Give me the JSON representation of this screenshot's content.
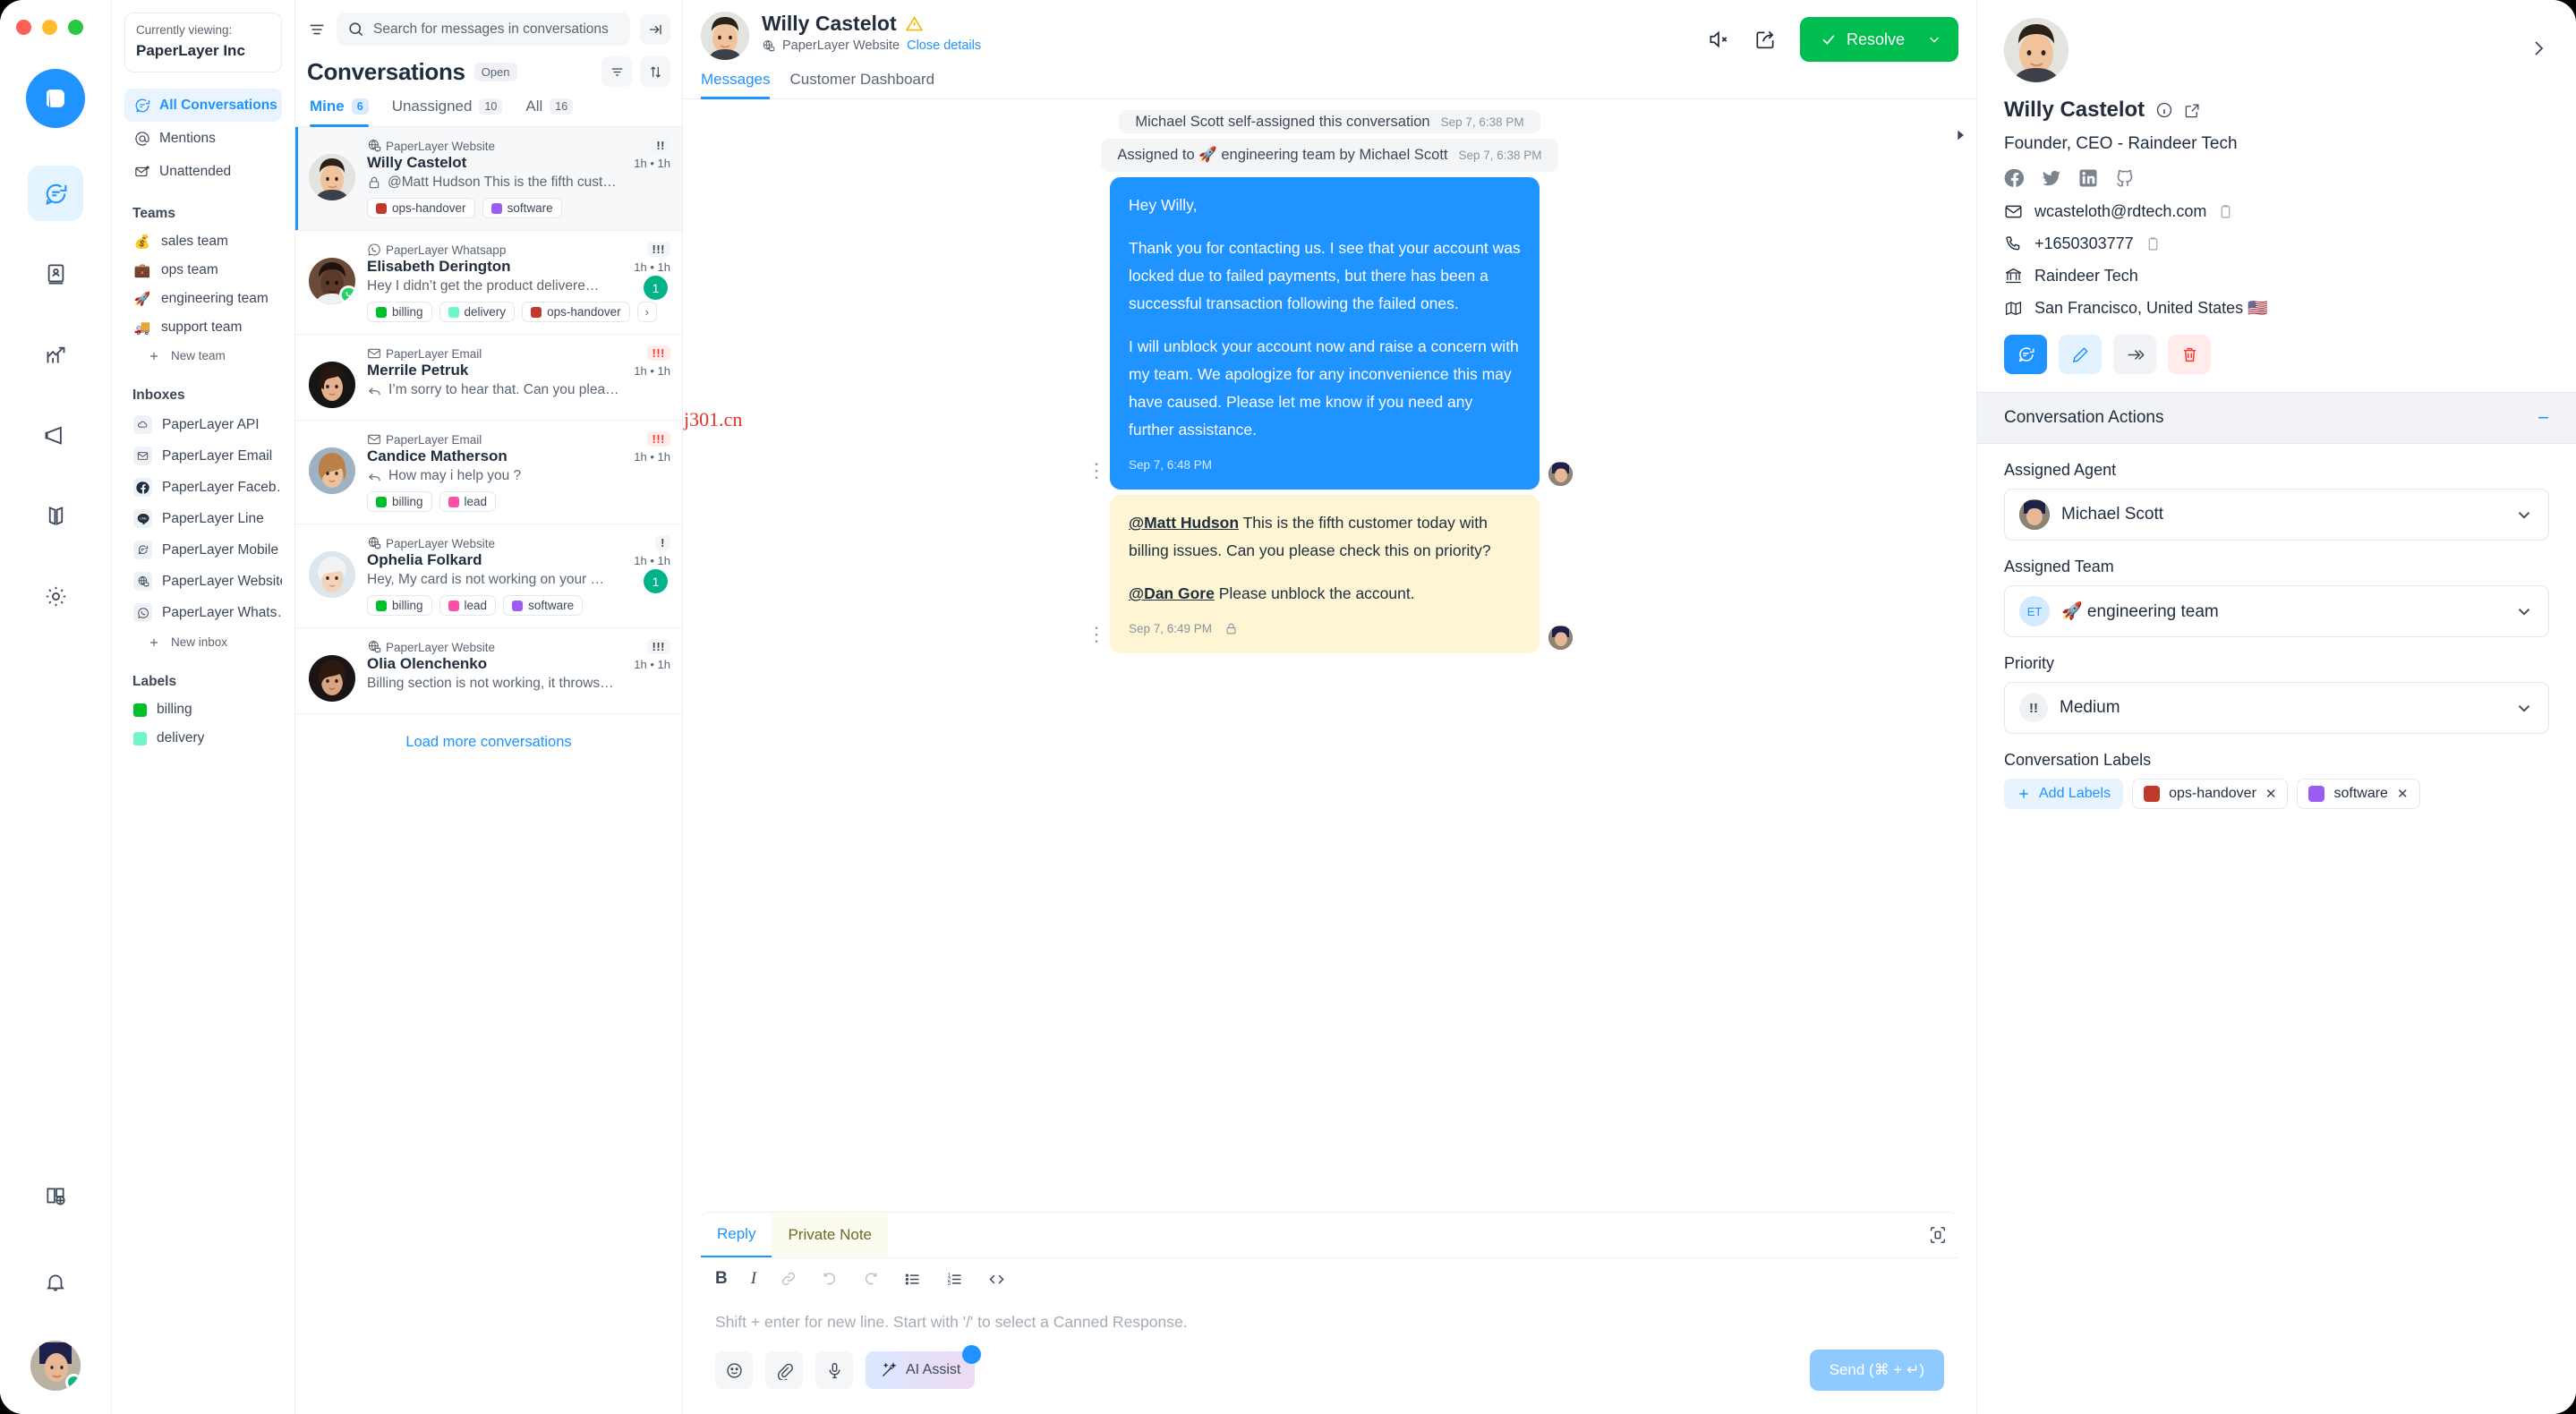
{
  "account": {
    "currently_viewing_label": "Currently viewing:",
    "name": "PaperLayer Inc"
  },
  "sidebar": {
    "primary_items": [
      {
        "label": "All Conversations",
        "icon": "chat-icon",
        "active": true
      },
      {
        "label": "Mentions",
        "icon": "at-icon",
        "active": false
      },
      {
        "label": "Unattended",
        "icon": "envelope-open-icon",
        "active": false
      }
    ],
    "teams_heading": "Teams",
    "teams": [
      {
        "emoji": "💰",
        "label": "sales team"
      },
      {
        "emoji": "💼",
        "label": "ops team"
      },
      {
        "emoji": "🚀",
        "label": "engineering team"
      },
      {
        "emoji": "🚚",
        "label": "support team"
      }
    ],
    "new_team_label": "New team",
    "inboxes_heading": "Inboxes",
    "inboxes": [
      {
        "label": "PaperLayer API",
        "icon": "cloud-icon"
      },
      {
        "label": "PaperLayer Email",
        "icon": "envelope-icon"
      },
      {
        "label": "PaperLayer Faceb…",
        "icon": "facebook-icon"
      },
      {
        "label": "PaperLayer Line",
        "icon": "line-icon"
      },
      {
        "label": "PaperLayer Mobile",
        "icon": "chat-icon"
      },
      {
        "label": "PaperLayer Website",
        "icon": "globe-screen-icon"
      },
      {
        "label": "PaperLayer Whats…",
        "icon": "whatsapp-icon"
      }
    ],
    "new_inbox_label": "New inbox",
    "labels_heading": "Labels",
    "labels": [
      {
        "label": "billing",
        "color": "#00bf2e"
      },
      {
        "label": "delivery",
        "color": "#6ef7c7"
      }
    ]
  },
  "conversation_list": {
    "search_placeholder": "Search for messages in conversations",
    "title": "Conversations",
    "status_chip": "Open",
    "tabs": [
      {
        "label": "Mine",
        "count": "6",
        "active": true
      },
      {
        "label": "Unassigned",
        "count": "10",
        "active": false
      },
      {
        "label": "All",
        "count": "16",
        "active": false
      }
    ],
    "load_more_label": "Load more conversations",
    "items": [
      {
        "inbox": "PaperLayer Website",
        "inbox_icon": "globe-screen-icon",
        "name": "Willy Castelot",
        "snippet": "@Matt Hudson This is the fifth cust…",
        "snippet_icon": "lock-icon",
        "time": "1h • 1h",
        "priority": "!!",
        "priority_level": "medium",
        "unread": "",
        "selected": true,
        "labels": [
          {
            "label": "ops-handover",
            "color": "#c0392b"
          },
          {
            "label": "software",
            "color": "#9b5cf6"
          }
        ],
        "more_labels": false
      },
      {
        "inbox": "PaperLayer Whatsapp",
        "inbox_icon": "whatsapp-icon",
        "name": "Elisabeth Derington",
        "snippet": "Hey I didn’t get the product delivere…",
        "snippet_icon": "",
        "time": "1h • 1h",
        "priority": "!!!",
        "priority_level": "medium",
        "unread": "1",
        "selected": false,
        "labels": [
          {
            "label": "billing",
            "color": "#00bf2e"
          },
          {
            "label": "delivery",
            "color": "#6ef7c7"
          },
          {
            "label": "ops-handover",
            "color": "#c0392b"
          }
        ],
        "more_labels": true
      },
      {
        "inbox": "PaperLayer Email",
        "inbox_icon": "envelope-icon",
        "name": "Merrile Petruk",
        "snippet": "I’m sorry to hear that. Can you plea…",
        "snippet_icon": "reply-icon",
        "time": "1h • 1h",
        "priority": "!!!",
        "priority_level": "urgent",
        "unread": "",
        "selected": false,
        "labels": [],
        "more_labels": false
      },
      {
        "inbox": "PaperLayer Email",
        "inbox_icon": "envelope-icon",
        "name": "Candice Matherson",
        "snippet": "How may i help you ?",
        "snippet_icon": "reply-icon",
        "time": "1h • 1h",
        "priority": "!!!",
        "priority_level": "urgent",
        "unread": "",
        "selected": false,
        "labels": [
          {
            "label": "billing",
            "color": "#00bf2e"
          },
          {
            "label": "lead",
            "color": "#fd4fa6"
          }
        ],
        "more_labels": false
      },
      {
        "inbox": "PaperLayer Website",
        "inbox_icon": "globe-screen-icon",
        "name": "Ophelia Folkard",
        "snippet": "Hey, My card is not working on your …",
        "snippet_icon": "",
        "time": "1h • 1h",
        "priority": "!",
        "priority_level": "medium",
        "unread": "1",
        "selected": false,
        "labels": [
          {
            "label": "billing",
            "color": "#00bf2e"
          },
          {
            "label": "lead",
            "color": "#fd4fa6"
          },
          {
            "label": "software",
            "color": "#9b5cf6"
          }
        ],
        "more_labels": false
      },
      {
        "inbox": "PaperLayer Website",
        "inbox_icon": "globe-screen-icon",
        "name": "Olia Olenchenko",
        "snippet": "Billing section is not working, it throws…",
        "snippet_icon": "",
        "time": "1h • 1h",
        "priority": "!!!",
        "priority_level": "medium",
        "unread": "",
        "selected": false,
        "labels": [],
        "more_labels": false
      }
    ]
  },
  "chat": {
    "contact_name": "Willy Castelot",
    "inbox": "PaperLayer Website",
    "close_details_label": "Close details",
    "tabs": [
      {
        "label": "Messages",
        "active": true
      },
      {
        "label": "Customer Dashboard",
        "active": false
      }
    ],
    "resolve_label": "Resolve",
    "system_messages": [
      {
        "text": "Michael Scott self-assigned this conversation",
        "time": "Sep 7, 6:38 PM"
      },
      {
        "text": "Assigned to 🚀 engineering team by Michael Scott",
        "time": "Sep 7, 6:38 PM"
      }
    ],
    "messages": [
      {
        "type": "outgoing",
        "paragraphs": [
          "Hey Willy,",
          "Thank you for contacting us. I see that your account was locked due to failed payments, but there has been a successful transaction following the failed ones.",
          "I will unblock your account now and raise a concern with my team. We apologize for any inconvenience this may have caused. Please let me know if you need any further assistance."
        ],
        "time": "Sep 7, 6:48 PM"
      },
      {
        "type": "note",
        "rich_paragraphs": [
          {
            "mention": "@Matt Hudson",
            "text": " This is the fifth customer today with billing issues. Can you please check this on priority?"
          },
          {
            "mention": "@Dan Gore",
            "text": " Please unblock the account."
          }
        ],
        "time": "Sep 7, 6:49 PM",
        "private": true
      }
    ],
    "watermark": "j301.cn"
  },
  "reply_box": {
    "tabs": [
      {
        "label": "Reply",
        "active": true
      },
      {
        "label": "Private Note",
        "active": false
      }
    ],
    "toolbar": [
      "bold",
      "italic",
      "link",
      "undo",
      "redo",
      "bullet-list",
      "numbered-list",
      "code"
    ],
    "placeholder": "Shift + enter for new line. Start with '/' to select a Canned Response.",
    "ai_assist_label": "AI Assist",
    "send_label": "Send (⌘ + ↵)"
  },
  "contact_panel": {
    "name": "Willy Castelot",
    "role": "Founder, CEO - Raindeer Tech",
    "socials": [
      "facebook-icon",
      "twitter-icon",
      "linkedin-icon",
      "github-icon"
    ],
    "email": "wcasteloth@rdtech.com",
    "phone": "+1650303777",
    "company": "Raindeer Tech",
    "location": "San Francisco, United States 🇺🇸",
    "actions_heading": "Conversation Actions",
    "assigned_agent_label": "Assigned Agent",
    "assigned_agent": "Michael Scott",
    "assigned_team_label": "Assigned Team",
    "assigned_team": "🚀 engineering team",
    "assigned_team_initials": "ET",
    "priority_label": "Priority",
    "priority_value": "Medium",
    "priority_icon": "!!",
    "labels_label": "Conversation Labels",
    "add_labels_label": "Add Labels",
    "labels": [
      {
        "label": "ops-handover",
        "color": "#c0392b"
      },
      {
        "label": "software",
        "color": "#9b5cf6"
      }
    ]
  },
  "colors": {
    "accent": "#1f93ff",
    "resolve_green": "#00bd4f",
    "note_yellow": "#fdf5d3",
    "unread_green": "#00b389",
    "urgent_red": "#ff382b"
  }
}
